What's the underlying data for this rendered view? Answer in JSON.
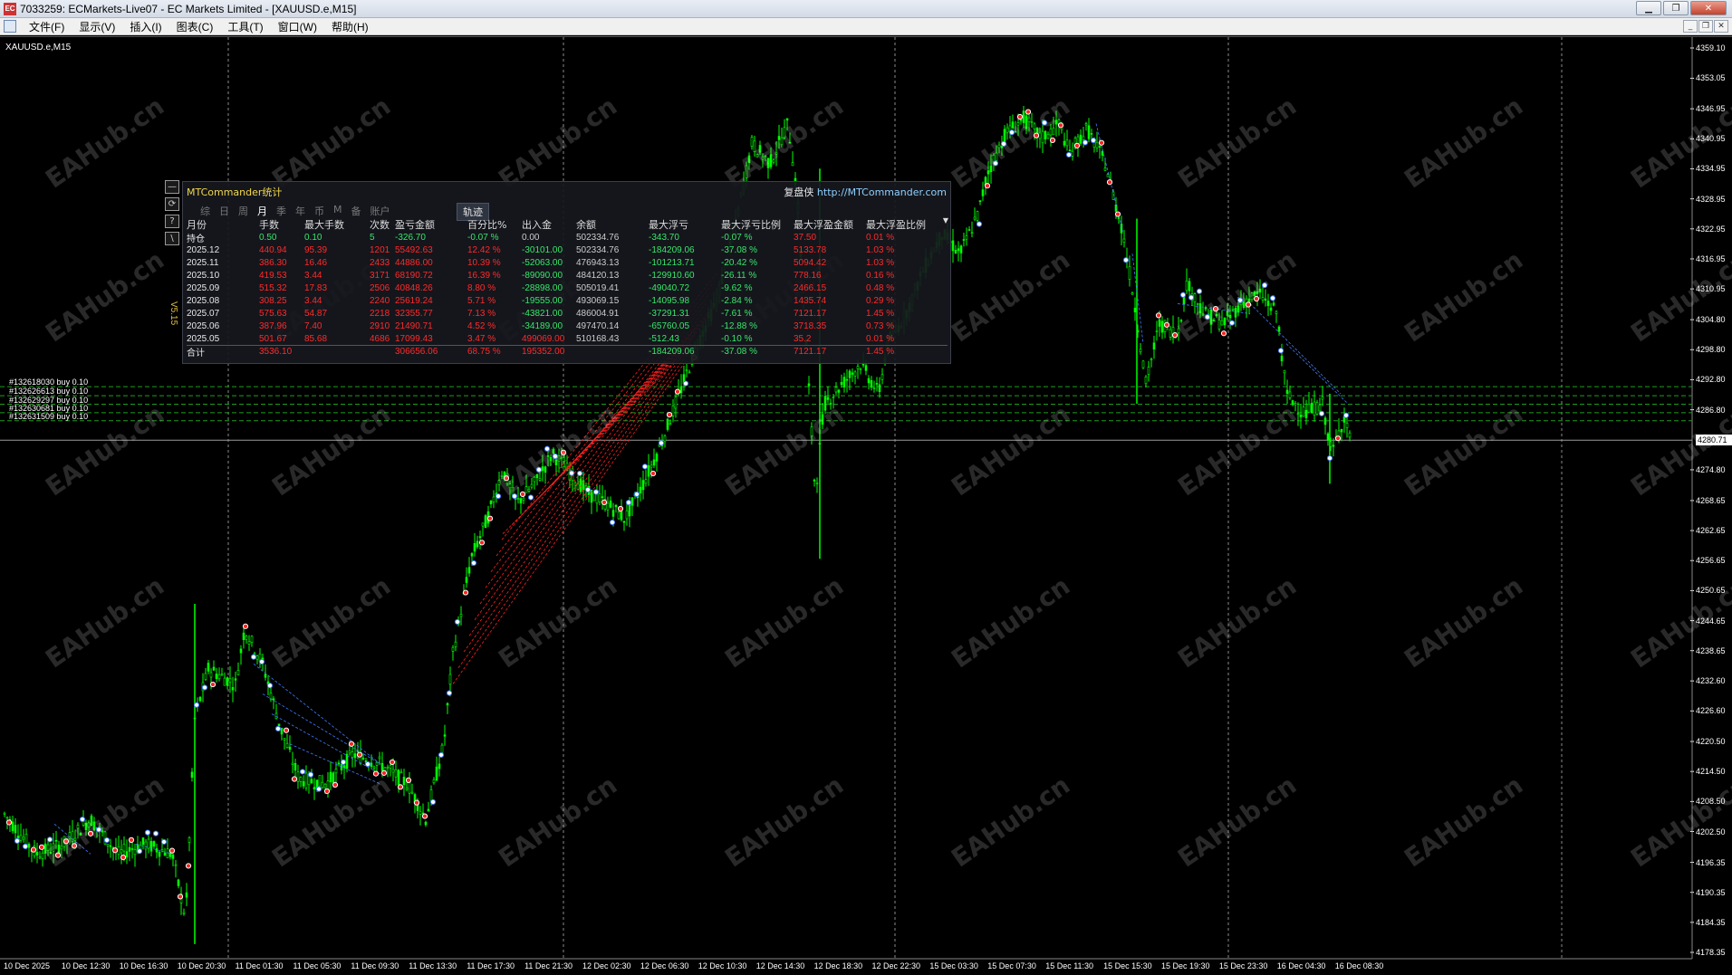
{
  "window": {
    "title": "7033259: ECMarkets-Live07 - EC Markets Limited - [XAUUSD.e,M15]",
    "app_icon": "EC",
    "buttons": [
      "minimize-icon",
      "restore-icon",
      "close-icon"
    ]
  },
  "menu": {
    "items": [
      "文件(F)",
      "显示(V)",
      "插入(I)",
      "图表(C)",
      "工具(T)",
      "窗口(W)",
      "帮助(H)"
    ]
  },
  "chart": {
    "symbol": "XAUUSD.e,M15",
    "watermark": "EAHub.cn",
    "current_price": "4280.71",
    "current_price_value": 4280.71,
    "price_ticks": [
      "4359.10",
      "4353.05",
      "4346.95",
      "4340.95",
      "4334.95",
      "4328.95",
      "4322.95",
      "4316.95",
      "4310.95",
      "4304.80",
      "4298.80",
      "4292.80",
      "4286.80",
      "4274.80",
      "4268.65",
      "4262.65",
      "4256.65",
      "4250.65",
      "4244.65",
      "4238.65",
      "4232.60",
      "4226.60",
      "4220.50",
      "4214.50",
      "4208.50",
      "4202.50",
      "4196.35",
      "4190.35",
      "4184.35",
      "4178.35"
    ],
    "time_ticks": [
      "10 Dec 2025",
      "10 Dec 12:30",
      "10 Dec 16:30",
      "10 Dec 20:30",
      "11 Dec 01:30",
      "11 Dec 05:30",
      "11 Dec 09:30",
      "11 Dec 13:30",
      "11 Dec 17:30",
      "11 Dec 21:30",
      "12 Dec 02:30",
      "12 Dec 06:30",
      "12 Dec 10:30",
      "12 Dec 14:30",
      "12 Dec 18:30",
      "12 Dec 22:30",
      "15 Dec 03:30",
      "15 Dec 07:30",
      "15 Dec 11:30",
      "15 Dec 15:30",
      "15 Dec 19:30",
      "15 Dec 23:30",
      "16 Dec 04:30",
      "16 Dec 08:30"
    ],
    "orders": [
      {
        "label": "#132618030 buy 0.10"
      },
      {
        "label": "#132626613 buy 0.10"
      },
      {
        "label": "#132629297 buy 0.10"
      },
      {
        "label": "#132630681 buy 0.10"
      },
      {
        "label": "#132631509 buy 0.10"
      }
    ],
    "colors": {
      "bull": "#00ff00",
      "bear": "#00ff00",
      "grid": "#8a8a8a",
      "order_line": "#1e9e1e",
      "buy_marker": "#3f7bff",
      "sell_marker": "#ff2020"
    }
  },
  "side_tools": {
    "icons": [
      "collapse-icon",
      "refresh-icon",
      "help-icon",
      "settings-icon"
    ],
    "labels": [
      "—",
      "⟳",
      "?",
      "\\"
    ],
    "version": "V5.15"
  },
  "panel": {
    "title": "MTCommander统计",
    "link_prefix": "复盘侠",
    "url": "http://MTCommander.com",
    "tabs": [
      "综",
      "日",
      "周",
      "月",
      "季",
      "年",
      "币",
      "M",
      "备",
      "账户"
    ],
    "active_tab": "月",
    "track_button": "轨迹",
    "headers": [
      "月份",
      "手数",
      "最大手数",
      "次数",
      "盈亏金额",
      "百分比%",
      "出入金",
      "余额",
      "最大浮亏",
      "最大浮亏比例",
      "最大浮盈金额",
      "最大浮盈比例"
    ],
    "rows": [
      {
        "cells": [
          "持仓",
          "0.50",
          "0.10",
          "5",
          "-326.70",
          "-0.07 %",
          "0.00",
          "502334.76",
          "-343.70",
          "-0.07 %",
          "37.50",
          "0.01 %"
        ],
        "colors": [
          "white",
          "green",
          "green",
          "green",
          "green",
          "green",
          "gray",
          "gray",
          "green",
          "green",
          "red",
          "red"
        ]
      },
      {
        "cells": [
          "2025.12",
          "440.94",
          "95.39",
          "1201",
          "55492.63",
          "12.42 %",
          "-30101.00",
          "502334.76",
          "-184209.06",
          "-37.08 %",
          "5133.78",
          "1.03 %"
        ],
        "colors": [
          "white",
          "red",
          "red",
          "red",
          "red",
          "red",
          "green",
          "gray",
          "green",
          "green",
          "red",
          "red"
        ]
      },
      {
        "cells": [
          "2025.11",
          "386.30",
          "16.46",
          "2433",
          "44886.00",
          "10.39 %",
          "-52063.00",
          "476943.13",
          "-101213.71",
          "-20.42 %",
          "5094.42",
          "1.03 %"
        ],
        "colors": [
          "white",
          "red",
          "red",
          "red",
          "red",
          "red",
          "green",
          "gray",
          "green",
          "green",
          "red",
          "red"
        ]
      },
      {
        "cells": [
          "2025.10",
          "419.53",
          "3.44",
          "3171",
          "68190.72",
          "16.39 %",
          "-89090.00",
          "484120.13",
          "-129910.60",
          "-26.11 %",
          "778.16",
          "0.16 %"
        ],
        "colors": [
          "white",
          "red",
          "red",
          "red",
          "red",
          "red",
          "green",
          "gray",
          "green",
          "green",
          "red",
          "red"
        ]
      },
      {
        "cells": [
          "2025.09",
          "515.32",
          "17.83",
          "2506",
          "40848.26",
          "8.80 %",
          "-28898.00",
          "505019.41",
          "-49040.72",
          "-9.62 %",
          "2466.15",
          "0.48 %"
        ],
        "colors": [
          "white",
          "red",
          "red",
          "red",
          "red",
          "red",
          "green",
          "gray",
          "green",
          "green",
          "red",
          "red"
        ]
      },
      {
        "cells": [
          "2025.08",
          "308.25",
          "3.44",
          "2240",
          "25619.24",
          "5.71 %",
          "-19555.00",
          "493069.15",
          "-14095.98",
          "-2.84 %",
          "1435.74",
          "0.29 %"
        ],
        "colors": [
          "white",
          "red",
          "red",
          "red",
          "red",
          "red",
          "green",
          "gray",
          "green",
          "green",
          "red",
          "red"
        ]
      },
      {
        "cells": [
          "2025.07",
          "575.63",
          "54.87",
          "2218",
          "32355.77",
          "7.13 %",
          "-43821.00",
          "486004.91",
          "-37291.31",
          "-7.61 %",
          "7121.17",
          "1.45 %"
        ],
        "colors": [
          "white",
          "red",
          "red",
          "red",
          "red",
          "red",
          "green",
          "gray",
          "green",
          "green",
          "red",
          "red"
        ]
      },
      {
        "cells": [
          "2025.06",
          "387.96",
          "7.40",
          "2910",
          "21490.71",
          "4.52 %",
          "-34189.00",
          "497470.14",
          "-65760.05",
          "-12.88 %",
          "3718.35",
          "0.73 %"
        ],
        "colors": [
          "white",
          "red",
          "red",
          "red",
          "red",
          "red",
          "green",
          "gray",
          "green",
          "green",
          "red",
          "red"
        ]
      },
      {
        "cells": [
          "2025.05",
          "501.67",
          "85.68",
          "4686",
          "17099.43",
          "3.47 %",
          "499069.00",
          "510168.43",
          "-512.43",
          "-0.10 %",
          "35.2",
          "0.01 %"
        ],
        "colors": [
          "white",
          "red",
          "red",
          "red",
          "red",
          "red",
          "red",
          "gray",
          "green",
          "green",
          "red",
          "red"
        ]
      },
      {
        "cells": [
          "合计",
          "3536.10",
          "",
          "",
          "306656.06",
          "68.75 %",
          "195352.00",
          "",
          "-184209.06",
          "-37.08 %",
          "7121.17",
          "1.45 %"
        ],
        "colors": [
          "white",
          "red",
          "red",
          "red",
          "red",
          "red",
          "red",
          "gray",
          "green",
          "green",
          "red",
          "red"
        ]
      }
    ]
  }
}
